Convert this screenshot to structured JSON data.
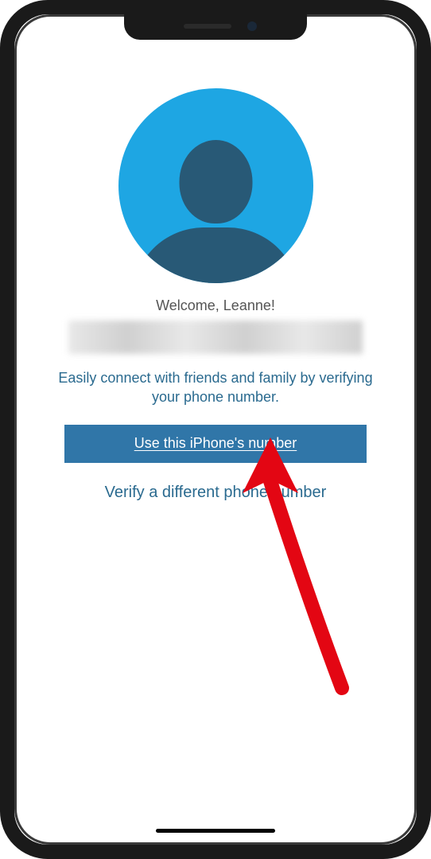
{
  "welcome": {
    "greeting": "Welcome, Leanne!",
    "instruction": "Easily connect with friends and family by verifying your phone number."
  },
  "buttons": {
    "primary": "Use this iPhone's number",
    "secondary": "Verify a different phone number"
  },
  "colors": {
    "avatar_bg": "#1ea6e3",
    "avatar_silhouette": "#285976",
    "primary_button": "#3076a8",
    "link_text": "#2a6a8f",
    "arrow": "#e30613"
  },
  "annotation": {
    "type": "arrow-pointer",
    "target": "use-this-number-button"
  }
}
